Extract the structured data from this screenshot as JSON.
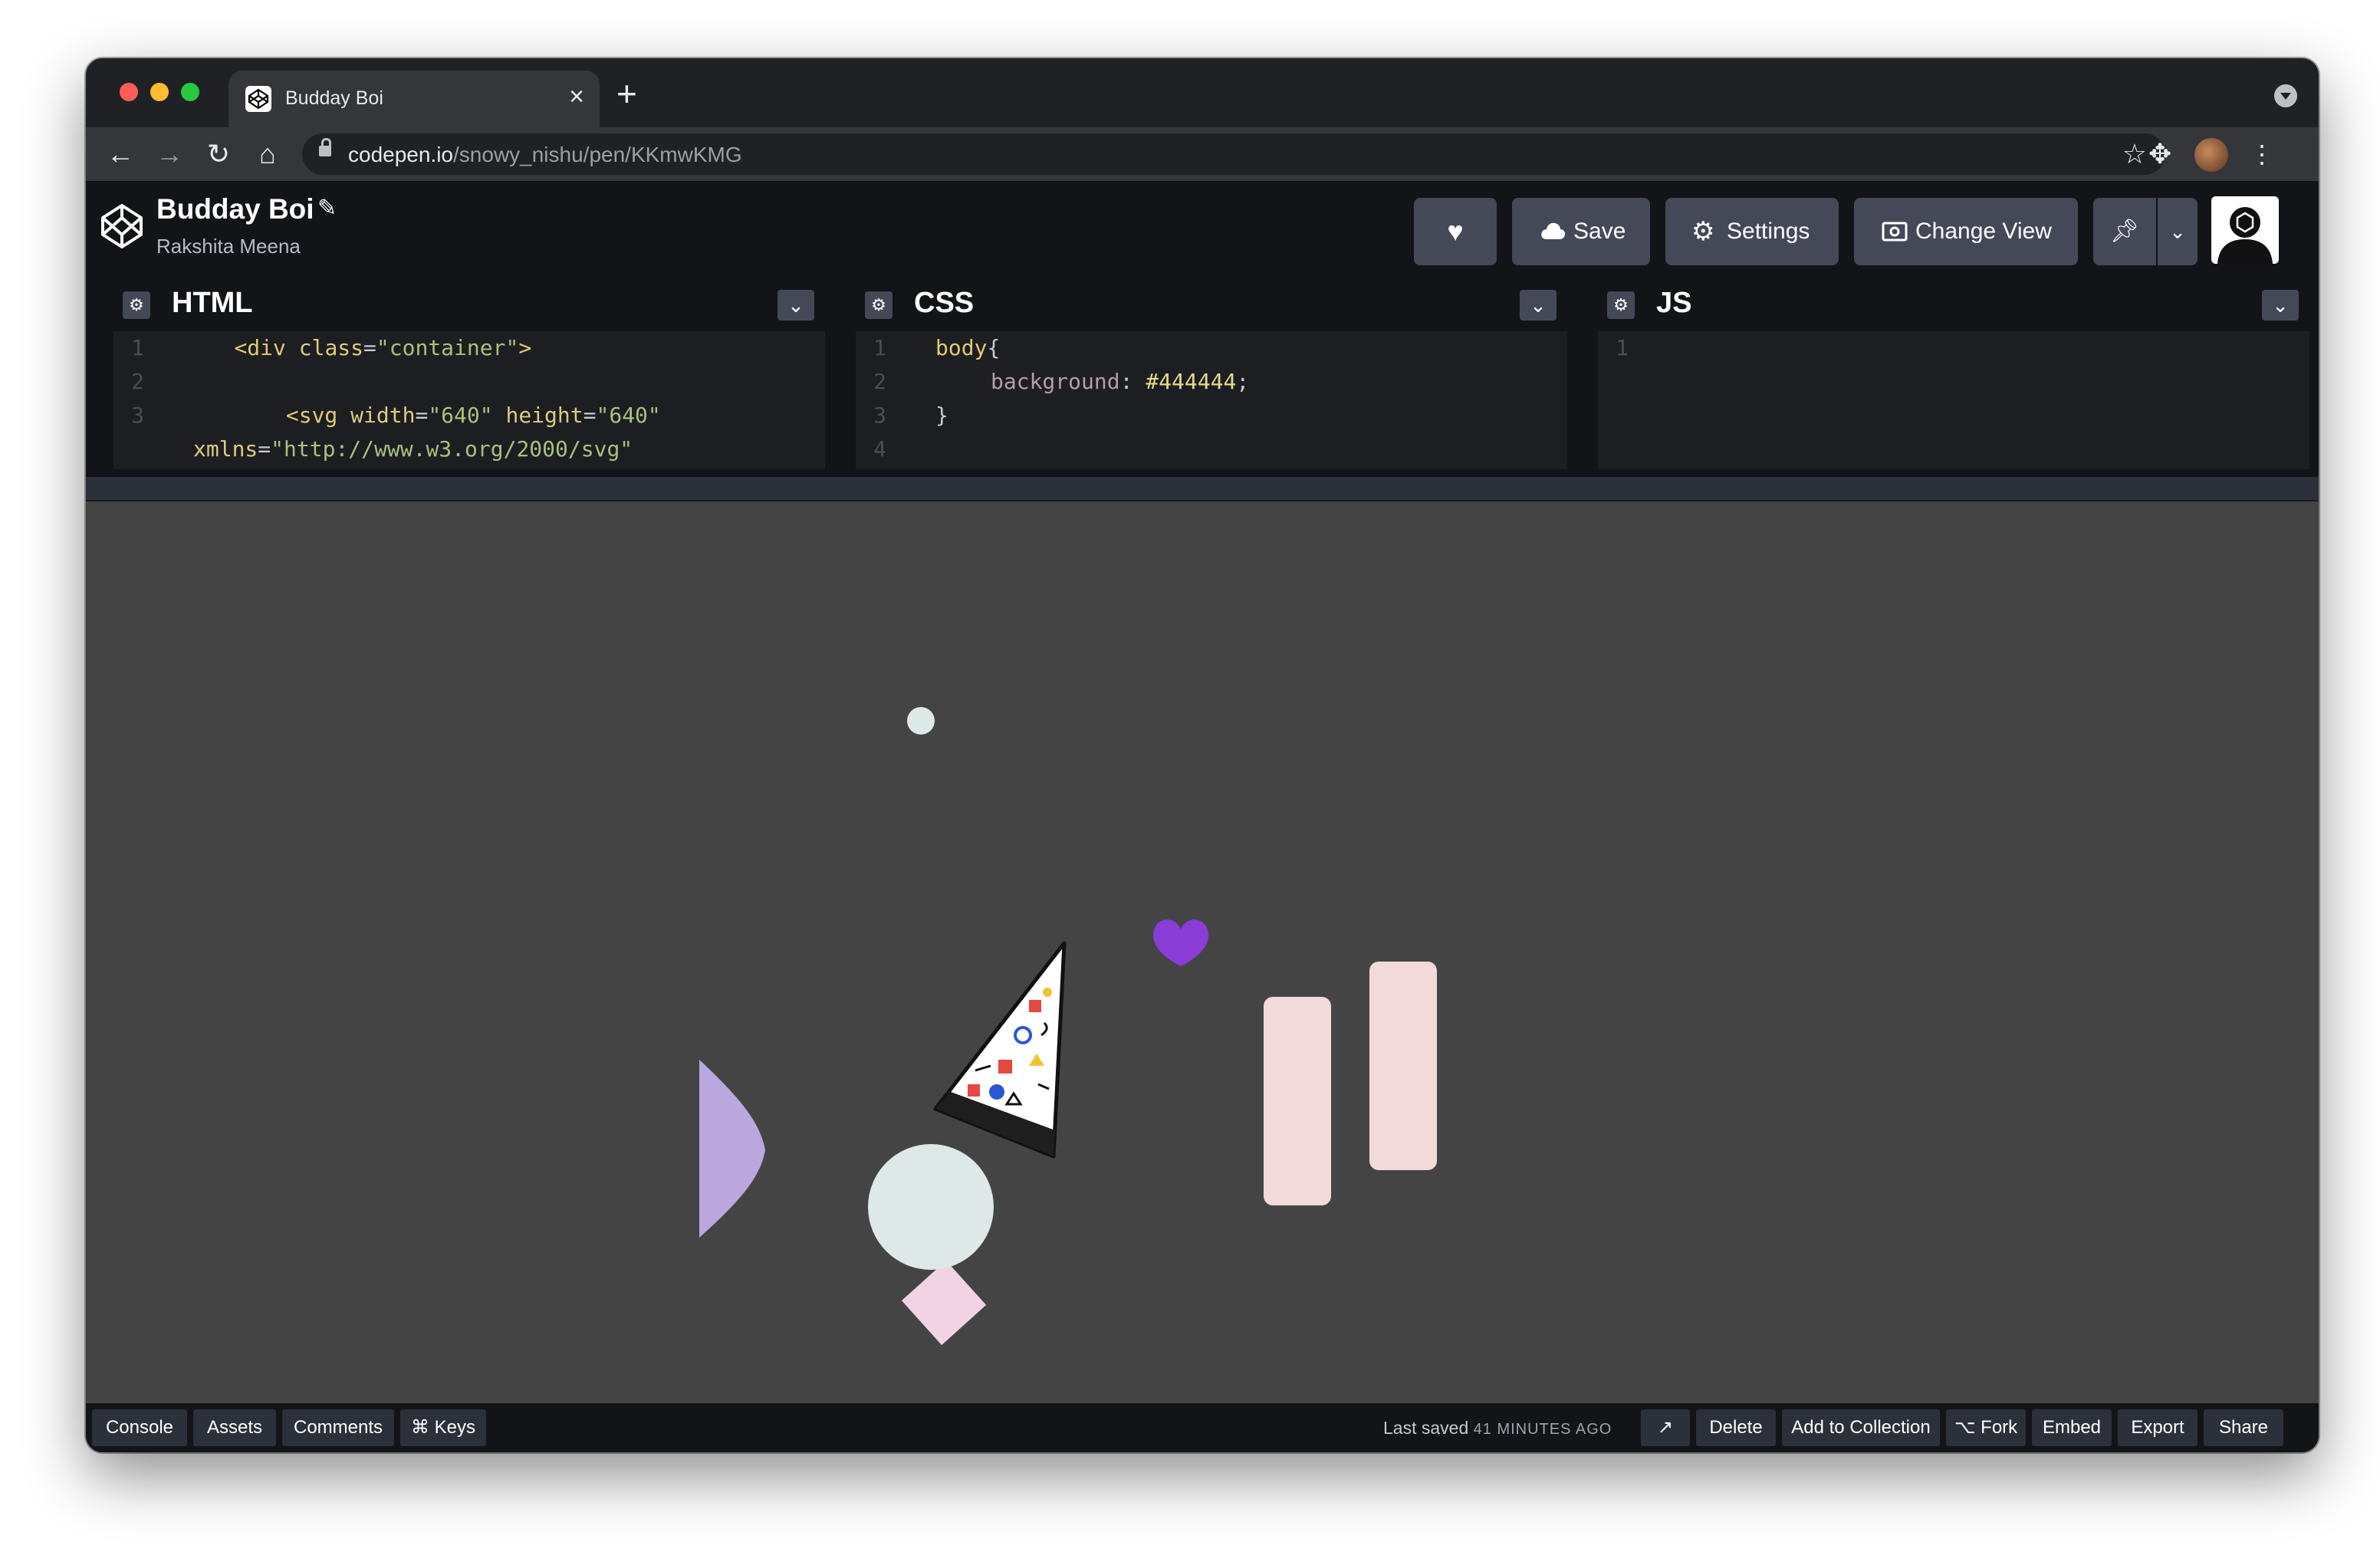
{
  "browser": {
    "tab_title": "Budday Boi",
    "url_host": "codepen.io",
    "url_path": "/snowy_nishu/pen/KKmwKMG"
  },
  "header": {
    "pen_title": "Budday Boi",
    "author": "Rakshita Meena",
    "save_label": "Save",
    "settings_label": "Settings",
    "change_view_label": "Change View"
  },
  "editors": {
    "html": {
      "name": "HTML",
      "line_numbers": [
        "1",
        "2",
        "3"
      ],
      "lines": [
        {
          "indent": "    ",
          "tag": "<div",
          "attr": " class",
          "eq": "=",
          "str": "\"container\"",
          "close": ">"
        }
      ],
      "svg_line": {
        "indent": "        ",
        "tag": "<svg",
        "a1": " width",
        "v1": "\"640\"",
        "a2": " height",
        "v2": "\"640\""
      },
      "xmlns_line": {
        "attr": "xmlns",
        "str": "\"http://www.w3.org/2000/svg\""
      }
    },
    "css": {
      "name": "CSS",
      "line_numbers": [
        "1",
        "2",
        "3",
        "4"
      ],
      "selector": "body",
      "open_brace": "{",
      "property": "background",
      "value": "#444444",
      "close_brace": "}"
    },
    "js": {
      "name": "JS",
      "line_numbers": [
        "1"
      ]
    }
  },
  "footer": {
    "console": "Console",
    "assets": "Assets",
    "comments": "Comments",
    "keys": "⌘ Keys",
    "last_saved": "Last saved",
    "saved_ago": "41 MINUTES AGO",
    "delete": "Delete",
    "add_to_collection": "Add to Collection",
    "fork": "⌥ Fork",
    "embed": "Embed",
    "export": "Export",
    "share": "Share"
  },
  "preview": {
    "background": "#444444",
    "colors": {
      "small_dot": "#dde9e6",
      "heart": "#8a3cd6",
      "pink_bars": "#f2d9da",
      "lavender_shape": "#b9a7dd",
      "face_circle": "#dde8e7",
      "pink_diamond": "#f2d3e3"
    }
  }
}
